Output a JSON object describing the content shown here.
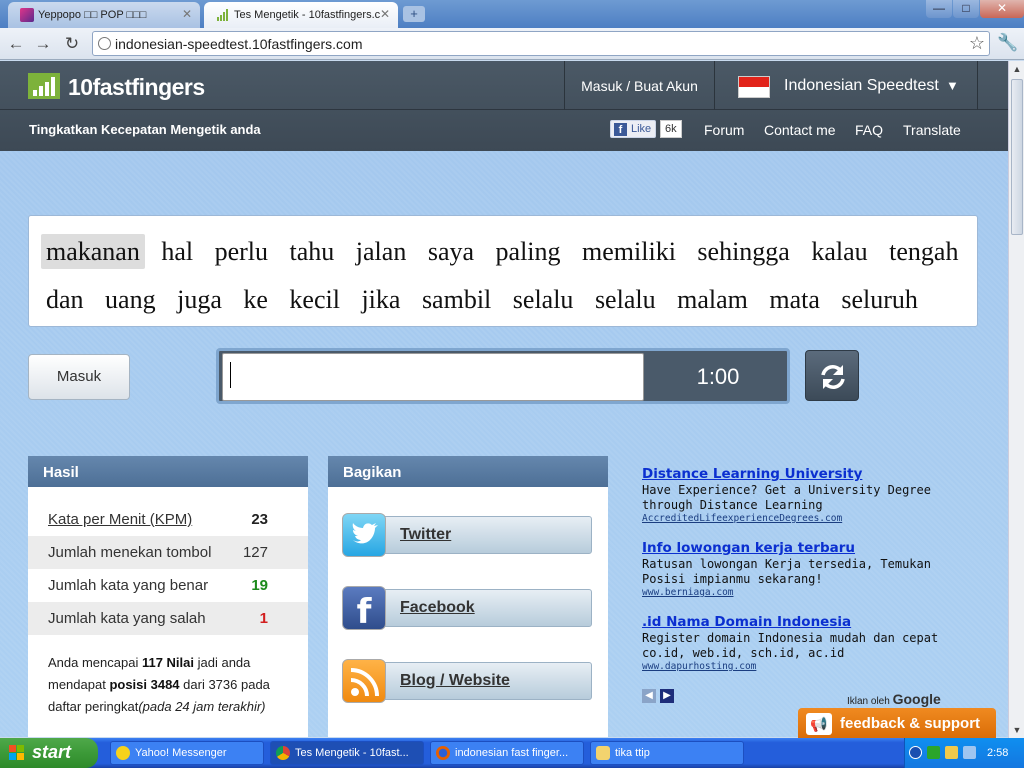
{
  "browser": {
    "tabs": [
      {
        "label": "Yeppopo □□ POP □□□",
        "active": false
      },
      {
        "label": "Tes Mengetik - 10fastfingers.c",
        "active": true
      }
    ],
    "url": "indonesian-speedtest.10fastfingers.com",
    "window_controls": {
      "minimize": "—",
      "maximize": "□",
      "close": "✕"
    }
  },
  "site": {
    "logo": "10fastfingers",
    "login_label": "Masuk / Buat Akun",
    "language": "Indonesian Speedtest",
    "tagline": "Tingkatkan Kecepatan Mengetik anda",
    "fb_like": "Like",
    "fb_count": "6k",
    "nav": [
      "Forum",
      "Contact me",
      "FAQ",
      "Translate"
    ]
  },
  "typing": {
    "words": [
      "makanan",
      "hal",
      "perlu",
      "tahu",
      "jalan",
      "saya",
      "paling",
      "memiliki",
      "sehingga",
      "kalau",
      "tengah",
      "dan",
      "uang",
      "juga",
      "ke",
      "kecil",
      "jika",
      "sambil",
      "selalu",
      "selalu",
      "malam",
      "mata",
      "seluruh"
    ],
    "current_index": 0,
    "masuk_label": "Masuk",
    "input_value": "",
    "timer": "1:00"
  },
  "results": {
    "title": "Hasil",
    "rows": [
      {
        "label": "Kata per Menit (KPM)",
        "value": "23"
      },
      {
        "label": "Jumlah menekan tombol",
        "value": "127"
      },
      {
        "label": "Jumlah kata yang benar",
        "value": "19"
      },
      {
        "label": "Jumlah kata yang salah",
        "value": "1"
      }
    ],
    "summary": {
      "t1": "Anda mencapai ",
      "score": "117 Nilai",
      "t2": " jadi anda mendapat ",
      "position": "posisi 3484",
      "t3": " dari 3736 pada daftar peringkat",
      "t4": "(pada 24 jam terakhir)"
    }
  },
  "share": {
    "title": "Bagikan",
    "buttons": [
      "Twitter",
      "Facebook",
      "Blog / Website"
    ]
  },
  "ads": [
    {
      "title": "Distance Learning University",
      "desc": "Have Experience? Get a University Degree through Distance Learning",
      "url": "AccreditedLifeexperienceDegrees.com"
    },
    {
      "title": "Info lowongan kerja terbaru",
      "desc": "Ratusan lowongan Kerja tersedia, Temukan Posisi impianmu sekarang!",
      "url": "www.berniaga.com"
    },
    {
      "title": ".id Nama Domain Indonesia",
      "desc": "Register domain Indonesia mudah dan cepat co.id, web.id, sch.id, ac.id",
      "url": "www.dapurhosting.com"
    }
  ],
  "ads_by": {
    "prefix": "Iklan oleh ",
    "brand": "Google"
  },
  "feedback": "feedback & support",
  "taskbar": {
    "start": "start",
    "tasks": [
      "Yahoo! Messenger",
      "Tes Mengetik - 10fast...",
      "indonesian fast finger...",
      "tika ttip"
    ],
    "clock": "2:58"
  },
  "colors": {
    "accent": "#4d6f96",
    "header": "#3d4955",
    "correct": "#1b8a1b",
    "wrong": "#d21f1f",
    "feedback": "#e87b10"
  }
}
